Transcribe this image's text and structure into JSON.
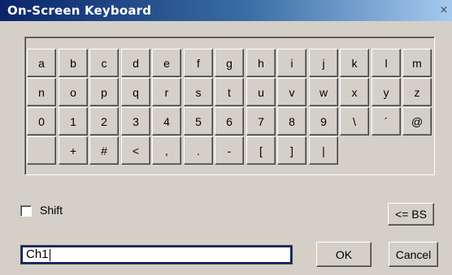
{
  "window": {
    "title": "On-Screen Keyboard",
    "close_glyph": "×"
  },
  "keys": [
    [
      "a",
      "b",
      "c",
      "d",
      "e",
      "f",
      "g",
      "h",
      "i",
      "j",
      "k",
      "l",
      "m"
    ],
    [
      "n",
      "o",
      "p",
      "q",
      "r",
      "s",
      "t",
      "u",
      "v",
      "w",
      "x",
      "y",
      "z"
    ],
    [
      "0",
      "1",
      "2",
      "3",
      "4",
      "5",
      "6",
      "7",
      "8",
      "9",
      "\\",
      "´",
      "@"
    ],
    [
      "",
      "+",
      "#",
      "<",
      ",",
      ".",
      "-",
      "[",
      "]",
      "|"
    ]
  ],
  "shift": {
    "label": "Shift",
    "checked": false
  },
  "backspace_label": "<= BS",
  "input": {
    "value": "Ch1"
  },
  "ok_label": "OK",
  "cancel_label": "Cancel"
}
